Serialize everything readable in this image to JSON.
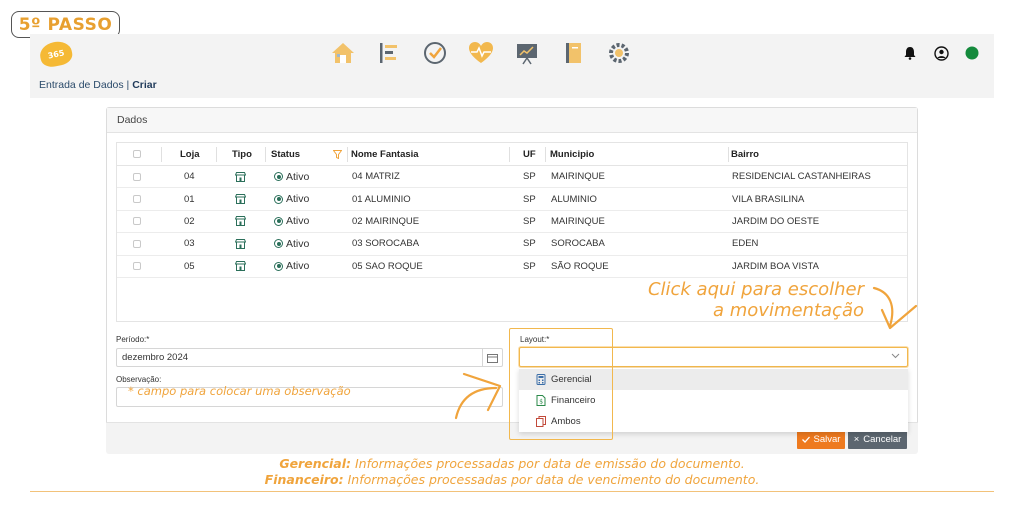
{
  "step_badge": "5º PASSO",
  "logo_text": "365",
  "nav_icons": [
    "home-icon",
    "list-icon",
    "check-circle-icon",
    "health-heart-icon",
    "chart-board-icon",
    "notebook-icon",
    "gear-cluster-icon"
  ],
  "header_right_icons": [
    "bell-icon",
    "user-circle-icon",
    "status-dot-icon"
  ],
  "colors": {
    "accent": "#f0a43c",
    "status_online": "#148a3c",
    "save_button": "#ee7a1f",
    "cancel_button": "#5c6670",
    "active_green": "#2b6f5a"
  },
  "breadcrumb": {
    "section": "Entrada de Dados |",
    "current": "Criar"
  },
  "card_title": "Dados",
  "table": {
    "columns": [
      "Loja",
      "Tipo",
      "Status",
      "Nome Fantasia",
      "UF",
      "Municipio",
      "Bairro"
    ],
    "rows": [
      {
        "loja": "04",
        "status": "Ativo",
        "nome": "04 MATRIZ",
        "uf": "SP",
        "municipio": "MAIRINQUE",
        "bairro": "RESIDENCIAL CASTANHEIRAS"
      },
      {
        "loja": "01",
        "status": "Ativo",
        "nome": "01 ALUMINIO",
        "uf": "SP",
        "municipio": "ALUMINIO",
        "bairro": "VILA BRASILINA"
      },
      {
        "loja": "02",
        "status": "Ativo",
        "nome": "02 MAIRINQUE",
        "uf": "SP",
        "municipio": "MAIRINQUE",
        "bairro": "JARDIM DO OESTE"
      },
      {
        "loja": "03",
        "status": "Ativo",
        "nome": "03 SOROCABA",
        "uf": "SP",
        "municipio": "SOROCABA",
        "bairro": "EDEN"
      },
      {
        "loja": "05",
        "status": "Ativo",
        "nome": "05 SAO ROQUE",
        "uf": "SP",
        "municipio": "SÃO ROQUE",
        "bairro": "JARDIM BOA VISTA"
      }
    ]
  },
  "form": {
    "periodo_label": "Período:*",
    "periodo_value": "dezembro 2024",
    "observacao_label": "Observação:",
    "observacao_hint": "* campo para colocar uma observação",
    "layout_label": "Layout:*",
    "layout_value": "",
    "layout_options": [
      "Gerencial",
      "Financeiro",
      "Ambos"
    ]
  },
  "buttons": {
    "save": "Salvar",
    "cancel": "Cancelar"
  },
  "callout": {
    "line1": "Click aqui para escolher",
    "line2": "a movimentação"
  },
  "notes": [
    {
      "term": "Gerencial:",
      "text": " Informações processadas por data de emissão do documento."
    },
    {
      "term": "Financeiro:",
      "text": " Informações processadas por data de vencimento do documento."
    }
  ]
}
